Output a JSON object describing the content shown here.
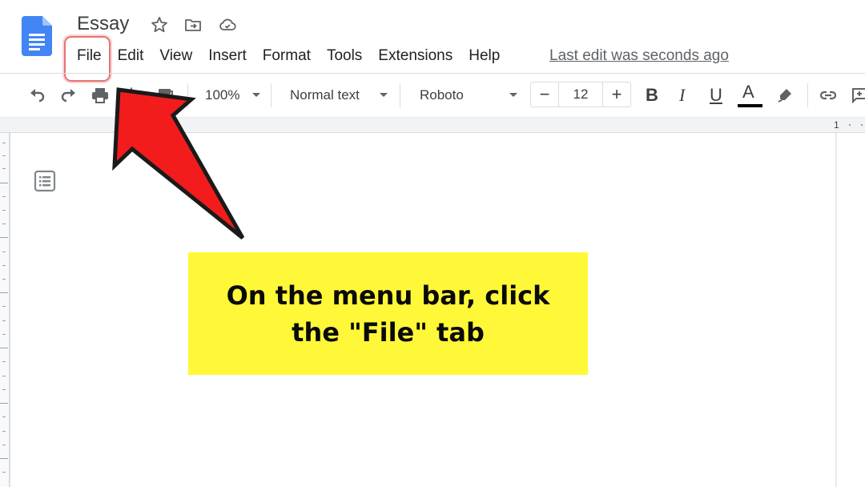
{
  "app": {
    "name": "Google Docs",
    "document_title": "Essay",
    "icons": {
      "logo": "docs-logo-icon",
      "star": "star-icon",
      "move": "folder-move-icon",
      "cloud": "cloud-saved-icon"
    }
  },
  "menubar": {
    "items": [
      {
        "label": "File"
      },
      {
        "label": "Edit"
      },
      {
        "label": "View"
      },
      {
        "label": "Insert"
      },
      {
        "label": "Format"
      },
      {
        "label": "Tools"
      },
      {
        "label": "Extensions"
      },
      {
        "label": "Help"
      }
    ],
    "last_edit": "Last edit was seconds ago",
    "highlighted_item": "File"
  },
  "toolbar": {
    "icons": [
      "undo-icon",
      "redo-icon",
      "print-icon",
      "spellcheck-icon",
      "paint-format-icon"
    ],
    "zoom": "100%",
    "style": "Normal text",
    "font": "Roboto",
    "font_size": "12",
    "minus": "−",
    "plus": "+",
    "bold": "B",
    "italic": "I",
    "underline": "U",
    "text_color": "A",
    "text_color_value": "#000000",
    "trailing_icons": [
      "highlight-icon",
      "link-icon",
      "add-comment-icon"
    ]
  },
  "ruler": {
    "marker": "1"
  },
  "annotation": {
    "text": "On the menu bar, click the \"File\" tab",
    "box_color": "#fff838",
    "arrow_color": "#f21c1c",
    "highlight_color": "#e57373"
  }
}
